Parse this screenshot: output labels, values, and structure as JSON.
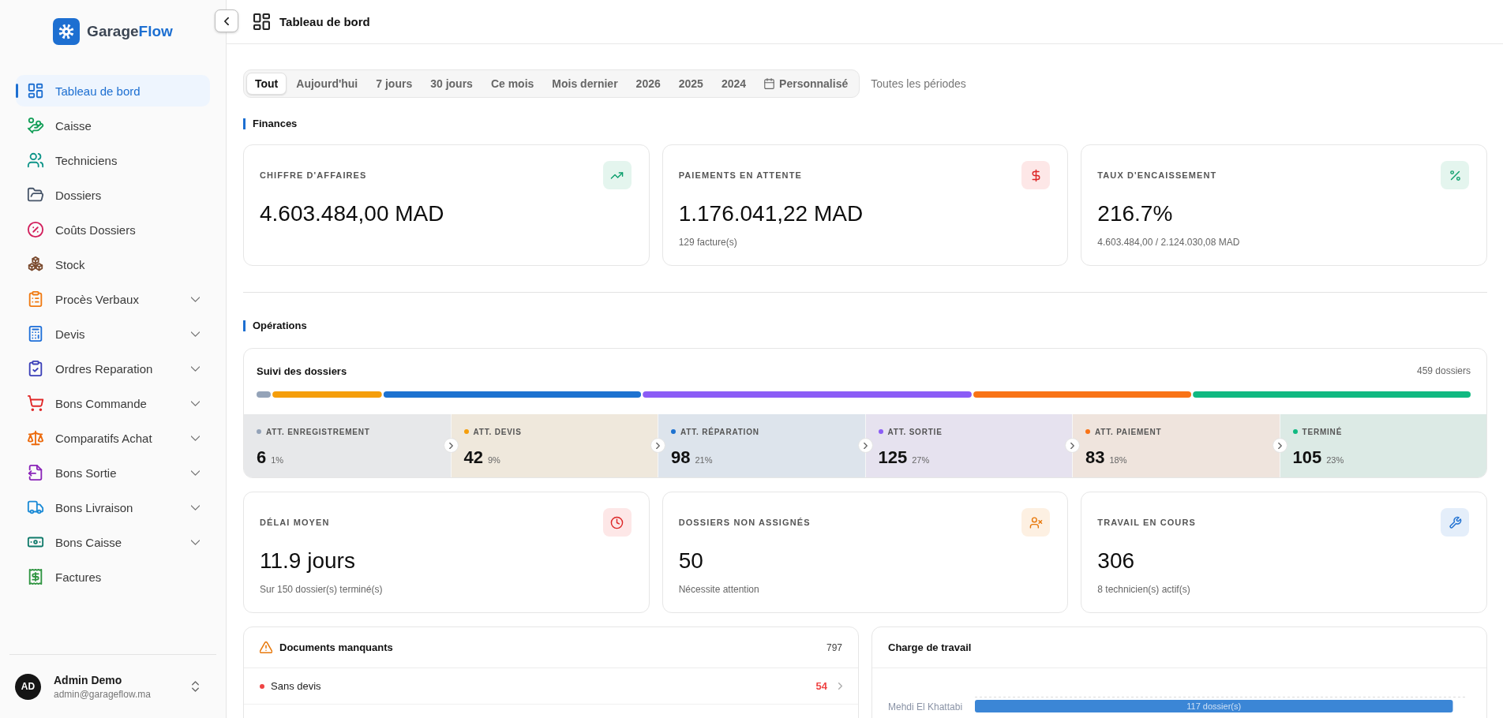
{
  "sidebar": {
    "brand": {
      "text": "Garage",
      "accent": "Flow"
    },
    "items": [
      {
        "label": "Tableau de bord",
        "selected": true,
        "has_submenu": false,
        "color": "#1d6fd1"
      },
      {
        "label": "Caisse",
        "selected": false,
        "has_submenu": false,
        "color": "#16a05a"
      },
      {
        "label": "Techniciens",
        "selected": false,
        "has_submenu": false,
        "color": "#0d9488"
      },
      {
        "label": "Dossiers",
        "selected": false,
        "has_submenu": false,
        "color": "#475569"
      },
      {
        "label": "Coûts Dossiers",
        "selected": false,
        "has_submenu": false,
        "color": "#d21f5c"
      },
      {
        "label": "Stock",
        "selected": false,
        "has_submenu": false,
        "color": "#7a4a2e"
      },
      {
        "label": "Procès Verbaux",
        "selected": false,
        "has_submenu": true,
        "color": "#f07a12"
      },
      {
        "label": "Devis",
        "selected": false,
        "has_submenu": true,
        "color": "#1e6fd9"
      },
      {
        "label": "Ordres Reparation",
        "selected": false,
        "has_submenu": true,
        "color": "#3b3fb8"
      },
      {
        "label": "Bons Commande",
        "selected": false,
        "has_submenu": true,
        "color": "#e02828"
      },
      {
        "label": "Comparatifs Achat",
        "selected": false,
        "has_submenu": true,
        "color": "#ec6a0c"
      },
      {
        "label": "Bons Sortie",
        "selected": false,
        "has_submenu": true,
        "color": "#8a24b8"
      },
      {
        "label": "Bons Livraison",
        "selected": false,
        "has_submenu": true,
        "color": "#1a8ad6"
      },
      {
        "label": "Bons Caisse",
        "selected": false,
        "has_submenu": true,
        "color": "#0f7a6a"
      },
      {
        "label": "Factures",
        "selected": false,
        "has_submenu": false,
        "color": "#2e9440"
      }
    ],
    "user": {
      "initials": "AD",
      "name": "Admin Demo",
      "email": "admin@garageflow.ma"
    }
  },
  "header": {
    "title": "Tableau de bord"
  },
  "period_filter": {
    "options": [
      {
        "label": "Tout",
        "selected": true,
        "kind": "preset"
      },
      {
        "label": "Aujourd'hui",
        "selected": false,
        "kind": "preset"
      },
      {
        "label": "7 jours",
        "selected": false,
        "kind": "preset"
      },
      {
        "label": "30 jours",
        "selected": false,
        "kind": "preset"
      },
      {
        "label": "Ce mois",
        "selected": false,
        "kind": "preset"
      },
      {
        "label": "Mois dernier",
        "selected": false,
        "kind": "preset"
      },
      {
        "label": "2026",
        "selected": false,
        "kind": "preset"
      },
      {
        "label": "2025",
        "selected": false,
        "kind": "preset"
      },
      {
        "label": "2024",
        "selected": false,
        "kind": "preset"
      },
      {
        "label": "Personnalisé",
        "selected": false,
        "kind": "custom"
      }
    ],
    "summary": "Toutes les périodes"
  },
  "finances": {
    "title": "Finances",
    "cards": [
      {
        "label": "CHIFFRE D'AFFAIRES",
        "value": "4.603.484,00 MAD"
      },
      {
        "label": "PAIEMENTS EN ATTENTE",
        "value": "1.176.041,22 MAD",
        "subtext": "129 facture(s)"
      },
      {
        "label": "TAUX D'ENCAISSEMENT",
        "value": "216.7%",
        "subtext": "4.603.484,00 / 2.124.030,08 MAD"
      }
    ]
  },
  "operations": {
    "title": "Opérations",
    "tracking": {
      "title": "Suivi des dossiers",
      "total": "459 dossiers",
      "stages": [
        {
          "label": "ATT. ENREGISTREMENT",
          "count": "6",
          "share": "1%",
          "color": "#94a3b8"
        },
        {
          "label": "ATT. DEVIS",
          "count": "42",
          "share": "9%",
          "color": "#f59e0b"
        },
        {
          "label": "ATT. RÉPARATION",
          "count": "98",
          "share": "21%",
          "color": "#1d72d0"
        },
        {
          "label": "ATT. SORTIE",
          "count": "125",
          "share": "27%",
          "color": "#8b5cf6"
        },
        {
          "label": "ATT. PAIEMENT",
          "count": "83",
          "share": "18%",
          "color": "#f97316"
        },
        {
          "label": "TERMINÉ",
          "count": "105",
          "share": "23%",
          "color": "#10b981"
        }
      ]
    },
    "cards": [
      {
        "label": "DÉLAI MOYEN",
        "value": "11.9 jours",
        "subtext": "Sur 150 dossier(s) terminé(s)"
      },
      {
        "label": "DOSSIERS NON ASSIGNÉS",
        "value": "50",
        "subtext": "Nécessite attention"
      },
      {
        "label": "TRAVAIL EN COURS",
        "value": "306",
        "subtext": "8 technicien(s) actif(s)"
      }
    ],
    "missing_documents": {
      "title": "Documents manquants",
      "total": "797",
      "rows": [
        {
          "label": "Sans devis",
          "count": "54",
          "color": "#ef4444"
        }
      ]
    },
    "workload": {
      "title": "Charge de travail",
      "chart_data": {
        "type": "bar",
        "orientation": "horizontal",
        "categories": [
          "Mehdi El Khattabi"
        ],
        "values": [
          117
        ],
        "value_labels": [
          "117 dossier(s)"
        ]
      }
    }
  }
}
